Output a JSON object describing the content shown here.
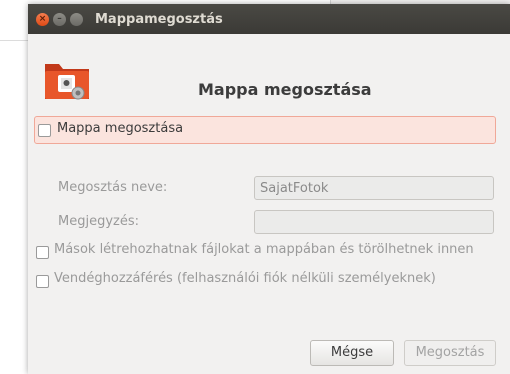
{
  "window": {
    "title": "Mappamegosztás"
  },
  "header": {
    "heading": "Mappa megosztása"
  },
  "share_checkbox": {
    "label": "Mappa megosztása",
    "checked": false
  },
  "share_name": {
    "label": "Megosztás neve:",
    "value": "SajatFotok"
  },
  "comment": {
    "label": "Megjegyzés:",
    "value": ""
  },
  "options": {
    "allow_others": {
      "label": "Mások létrehozhatnak fájlokat a mappában és törölhetnek innen",
      "checked": false
    },
    "guest_access": {
      "label": "Vendéghozzáférés (felhasználói fiók nélküli személyeknek)",
      "checked": false
    }
  },
  "buttons": {
    "cancel": "Mégse",
    "share": "Megosztás"
  },
  "colors": {
    "accent": "#df4a16",
    "highlight_bg": "#fbe4de",
    "highlight_border": "#f0a898",
    "titlebar": "#3b3a36"
  }
}
